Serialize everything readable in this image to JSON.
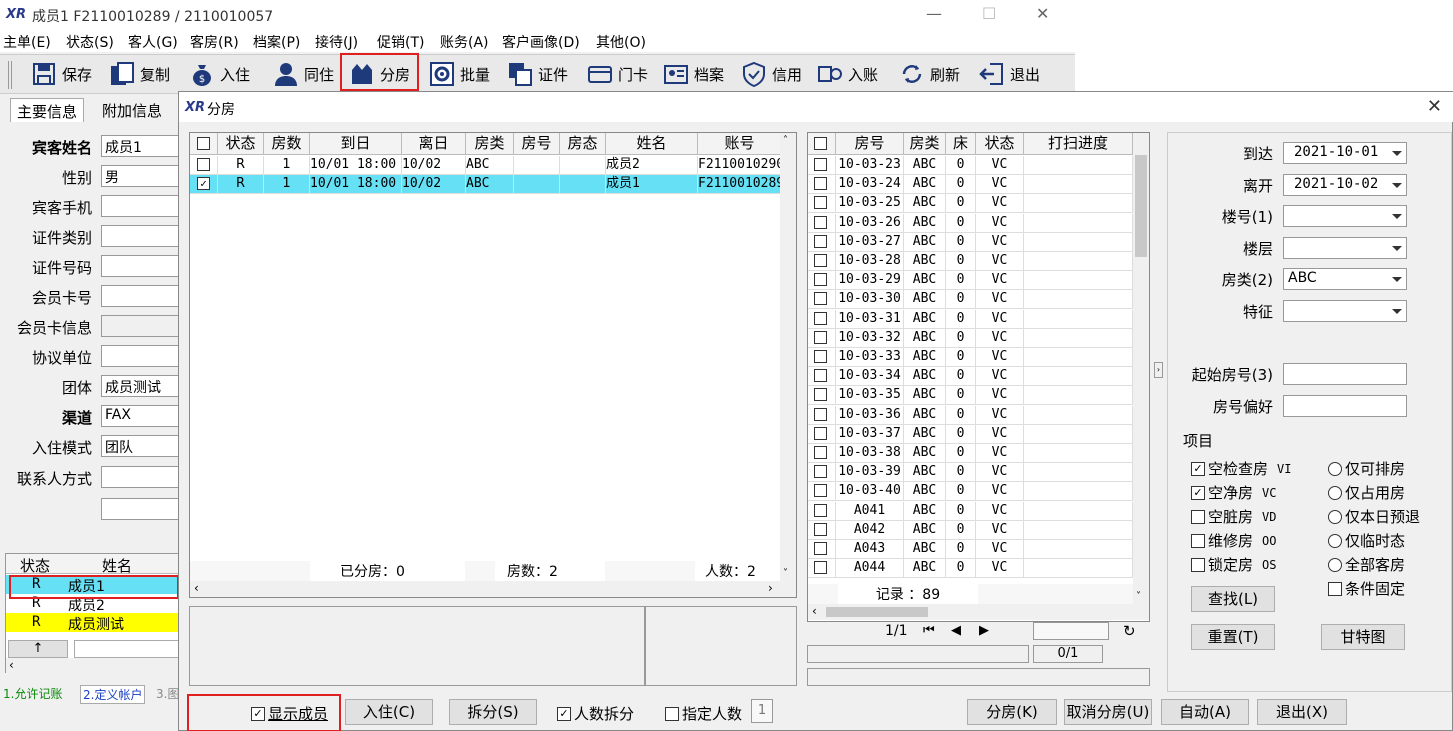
{
  "window": {
    "title": "成员1  F2110010289 / 2110010057",
    "logo": "XR",
    "min": "—",
    "max": "☐",
    "close": "✕"
  },
  "menu": [
    "主单(E)",
    "状态(S)",
    "客人(G)",
    "客房(R)",
    "档案(P)",
    "接待(J)",
    "促销(T)",
    "账务(A)",
    "客户画像(D)",
    "其他(O)"
  ],
  "toolbar": [
    {
      "label": "保存",
      "icon": "save-icon"
    },
    {
      "label": "复制",
      "icon": "copy-icon"
    },
    {
      "label": "入住",
      "icon": "moneybag-icon"
    },
    {
      "label": "同住",
      "icon": "person-icon"
    },
    {
      "label": "分房",
      "icon": "split-room-icon"
    },
    {
      "label": "批量",
      "icon": "batch-gear-icon"
    },
    {
      "label": "证件",
      "icon": "document-icon"
    },
    {
      "label": "门卡",
      "icon": "card-icon"
    },
    {
      "label": "档案",
      "icon": "profile-card-icon"
    },
    {
      "label": "信用",
      "icon": "shield-check-icon"
    },
    {
      "label": "入账",
      "icon": "post-charge-icon"
    },
    {
      "label": "刷新",
      "icon": "refresh-icon"
    },
    {
      "label": "退出",
      "icon": "exit-icon"
    }
  ],
  "left_tabs": [
    "主要信息",
    "附加信息"
  ],
  "guest_form": [
    {
      "label": "宾客姓名",
      "value": "成员1",
      "bold": true
    },
    {
      "label": "性别",
      "value": "男"
    },
    {
      "label": "宾客手机",
      "value": ""
    },
    {
      "label": "证件类别",
      "value": ""
    },
    {
      "label": "证件号码",
      "value": ""
    },
    {
      "label": "会员卡号",
      "value": ""
    },
    {
      "label": "会员卡信息",
      "value": ""
    },
    {
      "label": "协议单位",
      "value": ""
    },
    {
      "label": "团体",
      "value": "成员测试"
    },
    {
      "label": "渠道",
      "value": "FAX",
      "bold": true
    },
    {
      "label": "入住模式",
      "value": "团队"
    },
    {
      "label": "联系人方式",
      "value": ""
    }
  ],
  "member_list": {
    "headers": [
      "状态",
      "姓名"
    ],
    "rows": [
      {
        "status": "R",
        "name": "成员1"
      },
      {
        "status": "R",
        "name": "成员2"
      },
      {
        "status": "R",
        "name": "成员测试"
      }
    ],
    "up_arrow": "↑"
  },
  "bottom_tabs": [
    "1.允许记账",
    "2.定义帐户",
    "3.图"
  ],
  "dialog": {
    "title": "分房",
    "close": "✕",
    "assign_grid": {
      "headers": [
        "状态",
        "房数",
        "到日",
        "离日",
        "房类",
        "房号",
        "房态",
        "姓名",
        "账号"
      ],
      "rows": [
        {
          "checked": false,
          "status": "R",
          "rooms": "1",
          "arrive": "10/01 18:00",
          "depart": "10/02",
          "type": "ABC",
          "room": "",
          "rstate": "",
          "name": "成员2",
          "account": "F2110010290"
        },
        {
          "checked": true,
          "status": "R",
          "rooms": "1",
          "arrive": "10/01 18:00",
          "depart": "10/02",
          "type": "ABC",
          "room": "",
          "rstate": "",
          "name": "成员1",
          "account": "F2110010289"
        }
      ],
      "footer": {
        "assigned": "已分房：0",
        "rooms": "房数：2",
        "people": "人数：2"
      }
    },
    "room_grid": {
      "headers": [
        "房号",
        "房类",
        "床",
        "状态",
        "打扫进度"
      ],
      "rows": [
        {
          "no": "10-03-23",
          "type": "ABC",
          "bed": "0",
          "state": "VC"
        },
        {
          "no": "10-03-24",
          "type": "ABC",
          "bed": "0",
          "state": "VC"
        },
        {
          "no": "10-03-25",
          "type": "ABC",
          "bed": "0",
          "state": "VC"
        },
        {
          "no": "10-03-26",
          "type": "ABC",
          "bed": "0",
          "state": "VC"
        },
        {
          "no": "10-03-27",
          "type": "ABC",
          "bed": "0",
          "state": "VC"
        },
        {
          "no": "10-03-28",
          "type": "ABC",
          "bed": "0",
          "state": "VC"
        },
        {
          "no": "10-03-29",
          "type": "ABC",
          "bed": "0",
          "state": "VC"
        },
        {
          "no": "10-03-30",
          "type": "ABC",
          "bed": "0",
          "state": "VC"
        },
        {
          "no": "10-03-31",
          "type": "ABC",
          "bed": "0",
          "state": "VC"
        },
        {
          "no": "10-03-32",
          "type": "ABC",
          "bed": "0",
          "state": "VC"
        },
        {
          "no": "10-03-33",
          "type": "ABC",
          "bed": "0",
          "state": "VC"
        },
        {
          "no": "10-03-34",
          "type": "ABC",
          "bed": "0",
          "state": "VC"
        },
        {
          "no": "10-03-35",
          "type": "ABC",
          "bed": "0",
          "state": "VC"
        },
        {
          "no": "10-03-36",
          "type": "ABC",
          "bed": "0",
          "state": "VC"
        },
        {
          "no": "10-03-37",
          "type": "ABC",
          "bed": "0",
          "state": "VC"
        },
        {
          "no": "10-03-38",
          "type": "ABC",
          "bed": "0",
          "state": "VC"
        },
        {
          "no": "10-03-39",
          "type": "ABC",
          "bed": "0",
          "state": "VC"
        },
        {
          "no": "10-03-40",
          "type": "ABC",
          "bed": "0",
          "state": "VC"
        },
        {
          "no": "A041",
          "type": "ABC",
          "bed": "0",
          "state": "VC"
        },
        {
          "no": "A042",
          "type": "ABC",
          "bed": "0",
          "state": "VC"
        },
        {
          "no": "A043",
          "type": "ABC",
          "bed": "0",
          "state": "VC"
        },
        {
          "no": "A044",
          "type": "ABC",
          "bed": "0",
          "state": "VC"
        }
      ],
      "records": "记录 ：89",
      "page": "1/1",
      "progress_text": "0/1"
    },
    "filters": {
      "arrive_label": "到达",
      "arrive": "2021-10-01",
      "depart_label": "离开",
      "depart": "2021-10-02",
      "building_label": "楼号(1)",
      "building": "",
      "floor_label": "楼层",
      "floor": "",
      "roomtype_label": "房类(2)",
      "roomtype": "ABC",
      "feature_label": "特征",
      "feature": "",
      "start_room_label": "起始房号(3)",
      "start_room": "",
      "pref_label": "房号偏好",
      "pref": ""
    },
    "items_label": "项目",
    "check_options": [
      {
        "label": "空检查房",
        "code": "VI",
        "checked": true
      },
      {
        "label": "空净房",
        "code": "VC",
        "checked": true
      },
      {
        "label": "空脏房",
        "code": "VD",
        "checked": false
      },
      {
        "label": "维修房",
        "code": "OO",
        "checked": false
      },
      {
        "label": "锁定房",
        "code": "OS",
        "checked": false
      }
    ],
    "radio_options": [
      "仅可排房",
      "仅占用房",
      "仅本日预退",
      "仅临时态",
      "全部客房"
    ],
    "cond_fixed": "条件固定",
    "buttons": {
      "find": "查找(L)",
      "reset": "重置(T)",
      "gantt": "甘特图"
    },
    "bottom": {
      "show_members": "显示成员",
      "checkin": "入住(C)",
      "split": "拆分(S)",
      "people_split": "人数拆分",
      "specify_people": "指定人数",
      "specify_value": "1",
      "assign": "分房(K)",
      "cancel_assign": "取消分房(U)",
      "auto": "自动(A)",
      "exit": "退出(X)"
    }
  },
  "colors": {
    "selected": "#66e0f5",
    "highlight": "#ffff00",
    "red": "#e02020"
  }
}
